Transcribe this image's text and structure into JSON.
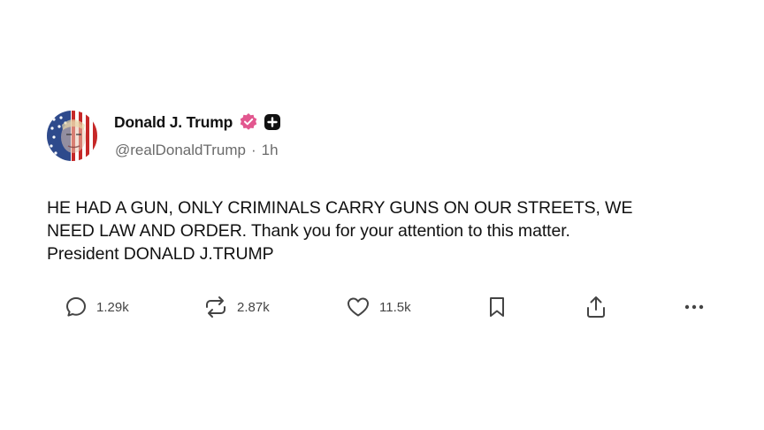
{
  "post": {
    "author_name": "Donald J. Trump",
    "handle": "@realDonaldTrump",
    "separator": "·",
    "time": "1h",
    "avatar_icon": "flag-portrait-avatar",
    "verified_icon": "verified-badge-icon",
    "follow_icon": "follow-plus-icon",
    "text_lines": [
      "HE HAD A GUN, ONLY CRIMINALS CARRY GUNS ON OUR STREETS, WE",
      "NEED LAW AND ORDER. Thank you for your attention to this matter.",
      "President DONALD J.TRUMP"
    ]
  },
  "actions": {
    "reply": {
      "icon": "reply-icon",
      "count": "1.29k"
    },
    "repost": {
      "icon": "repost-icon",
      "count": "2.87k"
    },
    "like": {
      "icon": "heart-icon",
      "count": "11.5k"
    },
    "bookmark": {
      "icon": "bookmark-icon"
    },
    "share": {
      "icon": "share-icon"
    },
    "more": {
      "icon": "more-icon"
    }
  },
  "colors": {
    "verified": "#e2578f",
    "text": "#111111",
    "secondary": "#6b6b6b",
    "icon": "#444444"
  }
}
